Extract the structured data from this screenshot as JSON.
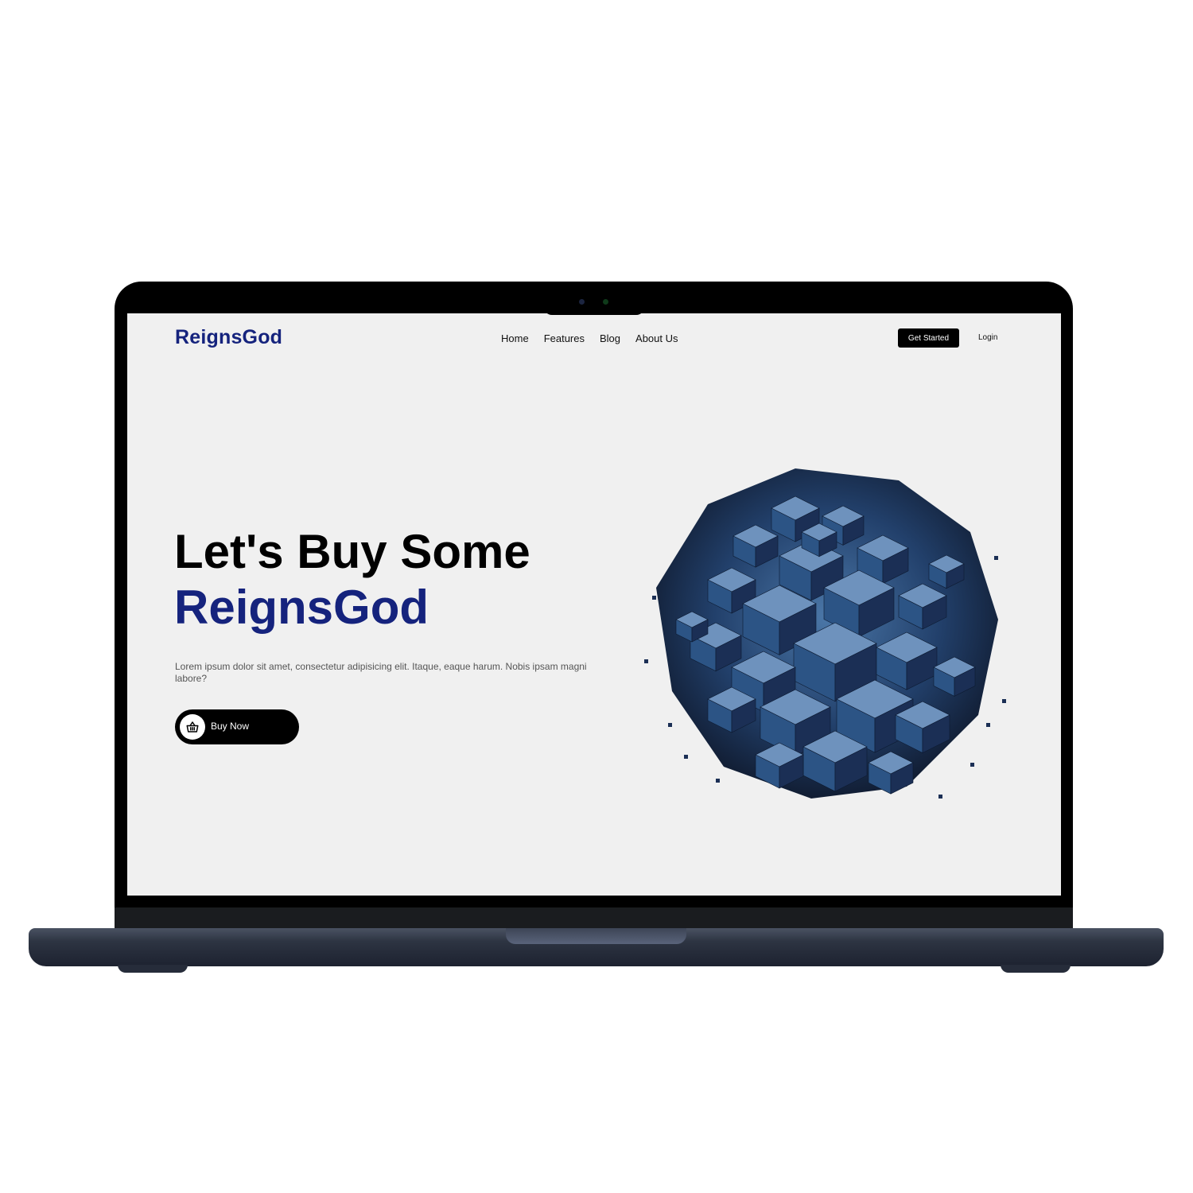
{
  "brand": {
    "logo": "ReignsGod"
  },
  "nav": {
    "items": [
      {
        "label": "Home"
      },
      {
        "label": "Features"
      },
      {
        "label": "Blog"
      },
      {
        "label": "About Us"
      }
    ],
    "get_started": "Get Started",
    "login": "Login"
  },
  "hero": {
    "line1": "Let's Buy Some",
    "line2": "ReignsGod",
    "description": "Lorem ipsum dolor sit amet, consectetur adipisicing elit. Itaque, eaque harum. Nobis ipsam magni labore?",
    "cta": {
      "label": "Buy Now",
      "icon": "basket-icon"
    },
    "image": "cube-cluster-illustration"
  },
  "colors": {
    "brand_blue": "#15237d",
    "screen_bg": "#f0f0f0",
    "cube_dark": "#1b2f55",
    "cube_mid": "#2c5485",
    "cube_light": "#6e92bd"
  }
}
